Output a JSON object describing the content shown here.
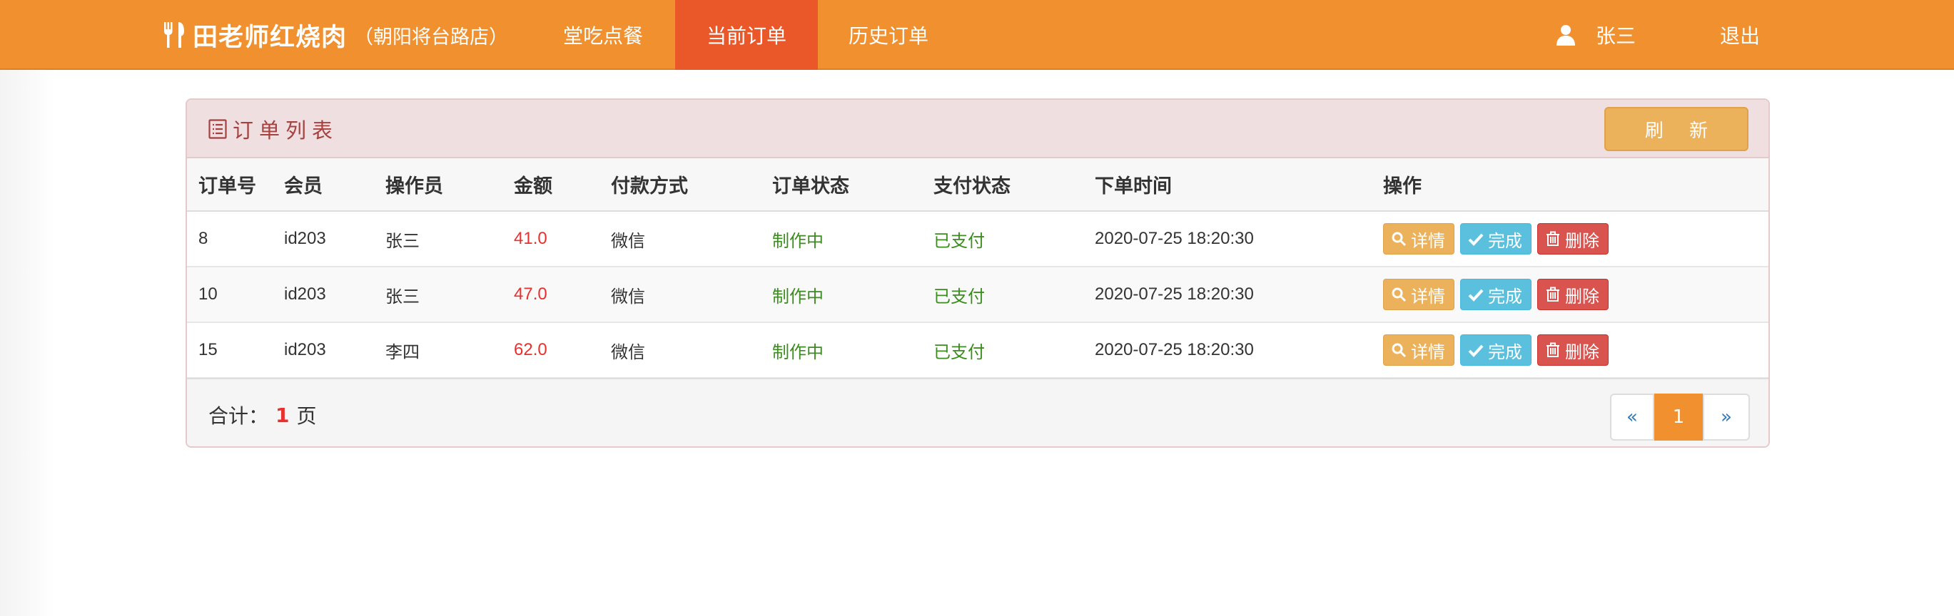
{
  "navbar": {
    "brand_name": "田老师红烧肉",
    "brand_sub": "（朝阳将台路店）",
    "items": [
      {
        "label": "堂吃点餐"
      },
      {
        "label": "当前订单"
      },
      {
        "label": "历史订单"
      }
    ],
    "active_index": 1,
    "user_name": "张三",
    "logout_label": "退出"
  },
  "panel": {
    "title": "订单列表",
    "refresh_label": "刷 新"
  },
  "table": {
    "columns": [
      "订单号",
      "会员",
      "操作员",
      "金额",
      "付款方式",
      "订单状态",
      "支付状态",
      "下单时间",
      "操作"
    ],
    "rows": [
      {
        "id": "8",
        "member": "id203",
        "operator": "张三",
        "amount": "41.0",
        "payment": "微信",
        "order_status": "制作中",
        "pay_status": "已支付",
        "time": "2020-07-25 18:20:30"
      },
      {
        "id": "10",
        "member": "id203",
        "operator": "张三",
        "amount": "47.0",
        "payment": "微信",
        "order_status": "制作中",
        "pay_status": "已支付",
        "time": "2020-07-25 18:20:30"
      },
      {
        "id": "15",
        "member": "id203",
        "operator": "李四",
        "amount": "62.0",
        "payment": "微信",
        "order_status": "制作中",
        "pay_status": "已支付",
        "time": "2020-07-25 18:20:30"
      }
    ],
    "actions": {
      "detail": "详情",
      "complete": "完成",
      "delete": "删除"
    }
  },
  "footer": {
    "total_prefix": "合计：",
    "total_pages": "1",
    "total_suffix": "页",
    "pager": {
      "prev": "«",
      "current": "1",
      "next": "»"
    }
  },
  "colors": {
    "navbar": "#f0902f",
    "nav_active": "#ea5728",
    "amount": "#e8312f",
    "status_green": "#3c8c1f"
  },
  "icons": [
    "utensils-icon",
    "user-icon",
    "list-icon",
    "search-icon",
    "check-icon",
    "trash-icon"
  ]
}
